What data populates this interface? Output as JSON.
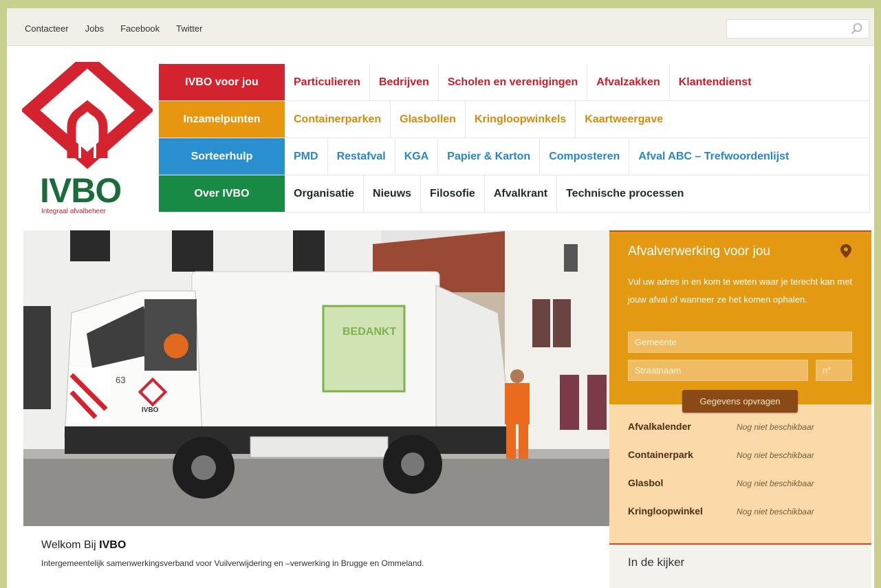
{
  "topbar": {
    "links": [
      "Contacteer",
      "Jobs",
      "Facebook",
      "Twitter"
    ],
    "search_placeholder": ""
  },
  "logo": {
    "wordmark": "IVBO",
    "tagline": "Integraal afvalbeheer"
  },
  "nav": {
    "rows": [
      {
        "category": "IVBO voor jou",
        "items": [
          "Particulieren",
          "Bedrijven",
          "Scholen en verenigingen",
          "Afvalzakken",
          "Klantendienst"
        ]
      },
      {
        "category": "Inzamelpunten",
        "items": [
          "Containerparken",
          "Glasbollen",
          "Kringloopwinkels",
          "Kaartweergave"
        ]
      },
      {
        "category": "Sorteerhulp",
        "items": [
          "PMD",
          "Restafval",
          "KGA",
          "Papier & Karton",
          "Composteren",
          "Afval ABC – Trefwoordenlijst"
        ]
      },
      {
        "category": "Over IVBO",
        "items": [
          "Organisatie",
          "Nieuws",
          "Filosofie",
          "Afvalkrant",
          "Technische processen"
        ]
      }
    ]
  },
  "hero": {
    "truck_number": "63",
    "truck_brand": "IVBO",
    "banner_text": "BEDANKT"
  },
  "sidebar": {
    "title": "Afvalverwerking voor jou",
    "description": "Vul uw adres in en kom te weten waar je terecht kan met jouw afval of wanneer ze het komen ophalen.",
    "municipality_placeholder": "Gemeente",
    "street_placeholder": "Straatnaam",
    "number_placeholder": "n°",
    "button_label": "Gegevens opvragen",
    "list": [
      {
        "key": "Afvalkalender",
        "value": "Nog niet beschikbaar"
      },
      {
        "key": "Containerpark",
        "value": "Nog niet beschikbaar"
      },
      {
        "key": "Glasbol",
        "value": "Nog niet beschikbaar"
      },
      {
        "key": "Kringloopwinkel",
        "value": "Nog niet beschikbaar"
      }
    ],
    "spotlight_title": "In de kijker"
  },
  "welcome": {
    "prefix": "Welkom Bij ",
    "brand": "IVBO",
    "subtitle": "Intergemeentelijk samenwerkingsverband voor Vuilverwijdering en –verwerking in Brugge en Ommeland."
  },
  "colors": {
    "red": "#d3232e",
    "orange": "#e6970f",
    "blue": "#2a8fcf",
    "green": "#198a45"
  }
}
